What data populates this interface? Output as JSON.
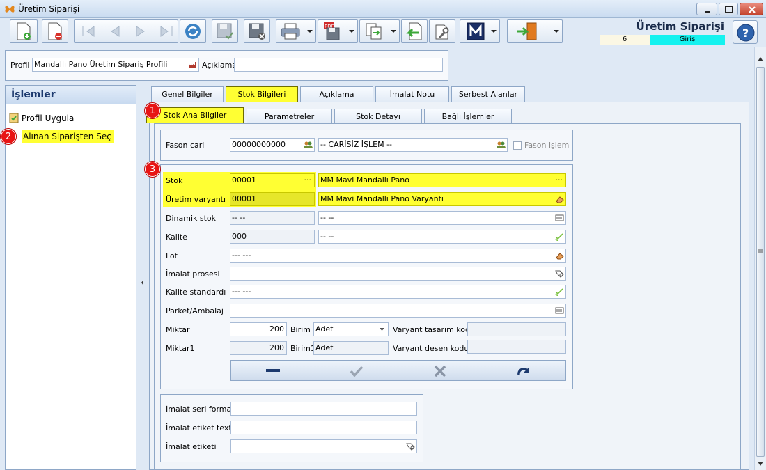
{
  "window": {
    "title": "Üretim Siparişi"
  },
  "header": {
    "form_title": "Üretim Siparişi",
    "number": "6",
    "mode": "Giriş"
  },
  "profile": {
    "label": "Profil",
    "value": "Mandallı Pano Üretim Sipariş Profili",
    "desc_label": "Açıklama",
    "desc_value": ""
  },
  "ops": {
    "title": "İşlemler",
    "items": [
      {
        "label": "Profil Uygula"
      },
      {
        "label": "Alınan Siparişten Seç"
      }
    ]
  },
  "badges": [
    "1",
    "2",
    "3"
  ],
  "tabs": [
    "Genel Bilgiler",
    "Stok Bilgileri",
    "Açıklama",
    "İmalat Notu",
    "Serbest Alanlar"
  ],
  "subtabs": [
    "Stok Ana Bilgiler",
    "Parametreler",
    "Stok Detayı",
    "Bağlı İşlemler"
  ],
  "fason": {
    "label": "Fason cari",
    "code": "00000000000",
    "name": "-- CARİSİZ İŞLEM --",
    "checkbox_label": "Fason işlem"
  },
  "fields": {
    "stok": {
      "label": "Stok",
      "code": "00001",
      "name": "MM Mavi Mandallı Pano",
      "dots": "···"
    },
    "variant": {
      "label": "Üretim varyantı",
      "code": "00001",
      "name": "MM Mavi Mandallı Pano Varyantı"
    },
    "dinamik": {
      "label": "Dinamik stok",
      "code": "-- --",
      "name": "-- --"
    },
    "kalite": {
      "label": "Kalite",
      "code": "000",
      "name": "-- --"
    },
    "lot": {
      "label": "Lot",
      "value": "--- ---"
    },
    "prosesi": {
      "label": "İmalat prosesi",
      "value": ""
    },
    "kalite_std": {
      "label": "Kalite standardı",
      "value": "--- ---"
    },
    "parket": {
      "label": "Parket/Ambalaj",
      "value": ""
    },
    "miktar": {
      "label": "Miktar",
      "value": "200",
      "birim_label": "Birim",
      "birim": "Adet",
      "vt_label": "Varyant tasarım kodu",
      "vt_value": ""
    },
    "miktar1": {
      "label": "Miktar1",
      "value": "200",
      "birim_label": "Birim1",
      "birim": "Adet",
      "vd_label": "Varyant desen kodu",
      "vd_value": ""
    }
  },
  "imalat": {
    "seri_label": "İmalat seri formatı",
    "seri_value": "",
    "etiket_text_label": "İmalat etiket text",
    "etiket_text_value": "",
    "etiket_label": "İmalat etiketi",
    "etiket_value": ""
  },
  "colors": {
    "highlight": "#ffff33",
    "badge": "#e81414",
    "mode_bg": "#15f2ef",
    "title_text": "#1a2b4a"
  }
}
